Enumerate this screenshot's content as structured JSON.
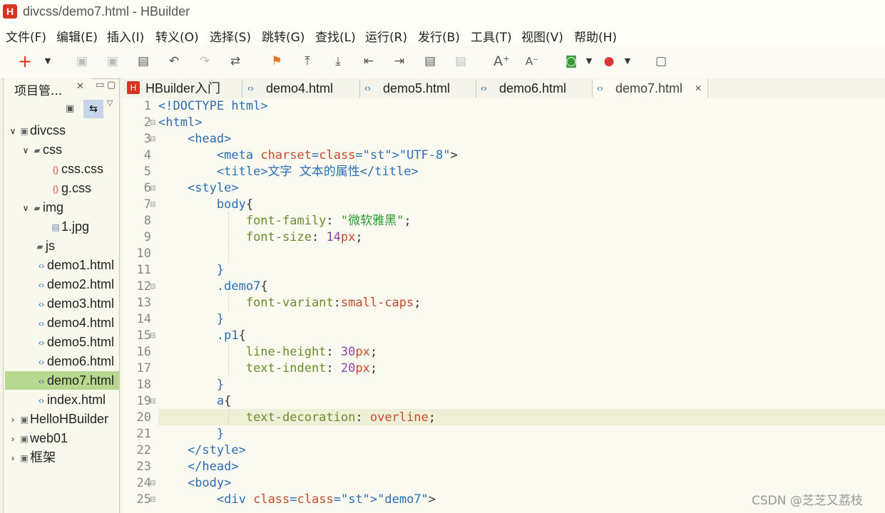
{
  "window": {
    "title": "divcss/demo7.html  -  HBuilder",
    "logo": "H"
  },
  "menu": [
    "文件(F)",
    "编辑(E)",
    "插入(I)",
    "转义(O)",
    "选择(S)",
    "跳转(G)",
    "查找(L)",
    "运行(R)",
    "发行(B)",
    "工具(T)",
    "视图(V)",
    "帮助(H)"
  ],
  "project_panel": {
    "tab_label": "项目管...",
    "tree": [
      {
        "label": "divcss",
        "expander": "∨",
        "icon": "project-icon"
      },
      {
        "label": "css",
        "expander": "∨",
        "icon": "folder-icon"
      },
      {
        "label": "css.css",
        "icon": "css-file-icon"
      },
      {
        "label": "g.css",
        "icon": "css-file-icon"
      },
      {
        "label": "img",
        "expander": "∨",
        "icon": "folder-icon"
      },
      {
        "label": "1.jpg",
        "icon": "image-file-icon"
      },
      {
        "label": "js",
        "icon": "folder-icon"
      },
      {
        "label": "demo1.html",
        "icon": "html-file-icon"
      },
      {
        "label": "demo2.html",
        "icon": "html-file-icon"
      },
      {
        "label": "demo3.html",
        "icon": "html-file-icon"
      },
      {
        "label": "demo4.html",
        "icon": "html-file-icon"
      },
      {
        "label": "demo5.html",
        "icon": "html-file-icon"
      },
      {
        "label": "demo6.html",
        "icon": "html-file-icon"
      },
      {
        "label": "demo7.html",
        "icon": "html-file-icon",
        "selected": true
      },
      {
        "label": "index.html",
        "icon": "html-file-icon"
      },
      {
        "label": "HelloHBuilder",
        "expander": "›",
        "icon": "project-icon"
      },
      {
        "label": "web01",
        "expander": "›",
        "icon": "project-icon"
      },
      {
        "label": "框架",
        "expander": "›",
        "icon": "project-icon"
      }
    ]
  },
  "editor_tabs": [
    "HBuilder入门",
    "demo4.html",
    "demo5.html",
    "demo6.html",
    "demo7.html"
  ],
  "code_lines": [
    {
      "n": "1",
      "t": "<!DOCTYPE html>"
    },
    {
      "n": "2",
      "t": "<html>"
    },
    {
      "n": "3",
      "t": "    <head>"
    },
    {
      "n": "4",
      "t": "        <meta charset=\"UTF-8\">"
    },
    {
      "n": "5",
      "t": "        <title>文字 文本的属性</title>"
    },
    {
      "n": "6",
      "t": "    <style>"
    },
    {
      "n": "7",
      "t": "        body{"
    },
    {
      "n": "8",
      "t": "            font-family: \"微软雅黑\";"
    },
    {
      "n": "9",
      "t": "            font-size: 14px;"
    },
    {
      "n": "10",
      "t": ""
    },
    {
      "n": "11",
      "t": "        }"
    },
    {
      "n": "12",
      "t": "        .demo7{"
    },
    {
      "n": "13",
      "t": "            font-variant:small-caps;"
    },
    {
      "n": "14",
      "t": "        }"
    },
    {
      "n": "15",
      "t": "        .p1{"
    },
    {
      "n": "16",
      "t": "            line-height: 30px;"
    },
    {
      "n": "17",
      "t": "            text-indent: 20px;"
    },
    {
      "n": "18",
      "t": "        }"
    },
    {
      "n": "19",
      "t": "        a{"
    },
    {
      "n": "20",
      "t": "            text-decoration: overline;"
    },
    {
      "n": "21",
      "t": "        }"
    },
    {
      "n": "22",
      "t": "    </style>"
    },
    {
      "n": "23",
      "t": "    </head>"
    },
    {
      "n": "24",
      "t": "    <body>"
    },
    {
      "n": "25",
      "t": "        <div class=\"demo7\">"
    }
  ],
  "watermark": "CSDN @芝芝又荔枝",
  "colors": {
    "accent": "#d6361f",
    "selection": "#b8d88f",
    "current_line": "#efefd8",
    "tag": "#2b6db5",
    "attr": "#c54b2a",
    "string": "#2a9a33",
    "property": "#6a8c2a",
    "number": "#8e44ad"
  }
}
